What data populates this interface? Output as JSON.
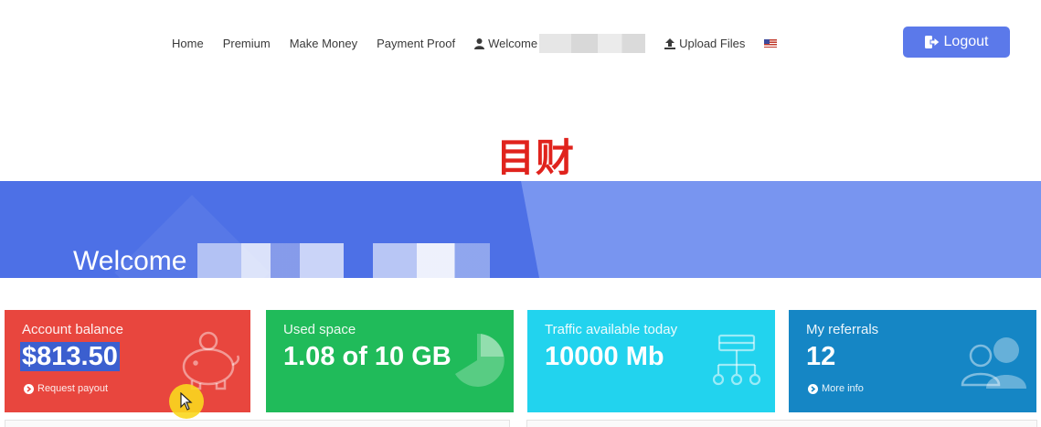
{
  "nav": {
    "links": [
      "Home",
      "Premium",
      "Make Money",
      "Payment Proof"
    ],
    "welcome_label": "Welcome",
    "upload_label": "Upload Files",
    "logout_label": "Logout"
  },
  "title": "目财",
  "hero": {
    "welcome": "Welcome"
  },
  "cards": [
    {
      "label": "Account balance",
      "value": "$813.50",
      "link": "Request payout"
    },
    {
      "label": "Used space",
      "value": "1.08 of 10 GB"
    },
    {
      "label": "Traffic available today",
      "value": "10000 Mb"
    },
    {
      "label": "My referrals",
      "value": "12",
      "link": "More info"
    }
  ],
  "colors": {
    "accent": "#5b79ea",
    "hero": "#4d70e6",
    "card_red": "#e8463e",
    "card_green": "#20bb5a",
    "card_cyan": "#22d3ee",
    "card_blue": "#1586c5",
    "title_red": "#e0231d"
  },
  "icons": [
    "user-icon",
    "upload-icon",
    "us-flag-icon",
    "logout-icon",
    "piggy-bank-icon",
    "pie-chart-icon",
    "network-icon",
    "users-icon",
    "chevron-circle-icon",
    "cursor-icon"
  ]
}
